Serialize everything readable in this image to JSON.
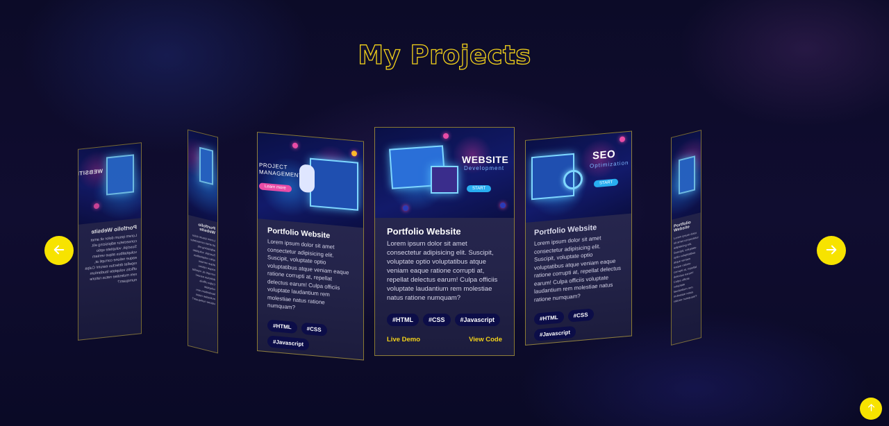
{
  "page": {
    "title": "My Projects"
  },
  "project": {
    "title": "Portfolio Website",
    "description": "Lorem ipsum dolor sit amet consectetur adipisicing elit. Suscipit, voluptate optio voluptatibus atque veniam eaque ratione corrupti at, repellat delectus earum! Culpa officiis voluptate laudantium rem molestiae natus ratione numquam?",
    "tags": [
      "#HTML",
      "#CSS",
      "#Javascript"
    ],
    "live_demo": "Live Demo",
    "view_code": "View Code"
  },
  "images": {
    "project_mgmt": {
      "line1": "PROJECT",
      "line2": "MANAGEMENT",
      "button": "Learn more"
    },
    "website": {
      "title": "WEBSITE",
      "subtitle": "Development",
      "button": "START"
    },
    "seo": {
      "title": "SEO",
      "subtitle": "Optimization",
      "button": "START"
    }
  },
  "colors": {
    "accent": "#f7e300",
    "background": "#0b0a24",
    "tag_bg": "#0c0d48"
  },
  "icons": {
    "prev": "arrow-left-icon",
    "next": "arrow-right-icon",
    "top": "arrow-up-icon"
  }
}
